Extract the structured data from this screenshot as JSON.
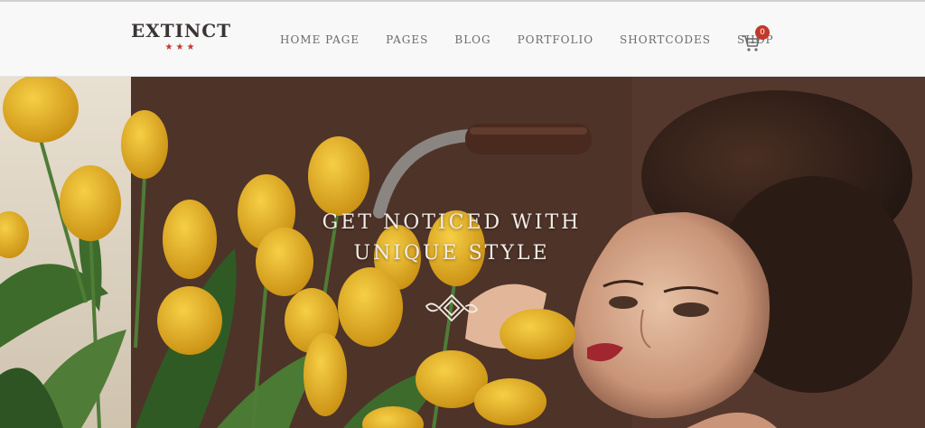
{
  "brand": {
    "name": "EXTINCT",
    "stars": "★★★"
  },
  "nav": {
    "items": [
      {
        "label": "HOME PAGE"
      },
      {
        "label": "PAGES"
      },
      {
        "label": "BLOG"
      },
      {
        "label": "PORTFOLIO"
      },
      {
        "label": "SHORTCODES"
      },
      {
        "label": "SHOP"
      }
    ]
  },
  "cart": {
    "icon": "shopping-cart-icon",
    "count": "0"
  },
  "hero": {
    "line1": "GET NOTICED WITH",
    "line2": "UNIQUE STYLE",
    "ornament_icon": "flourish-ornament-icon"
  },
  "colors": {
    "accent": "#c0392b",
    "nav_text": "#6b6b6b",
    "header_bg": "#f8f8f8",
    "hero_text": "#f3ede6",
    "tulip": "#e9b92a"
  }
}
